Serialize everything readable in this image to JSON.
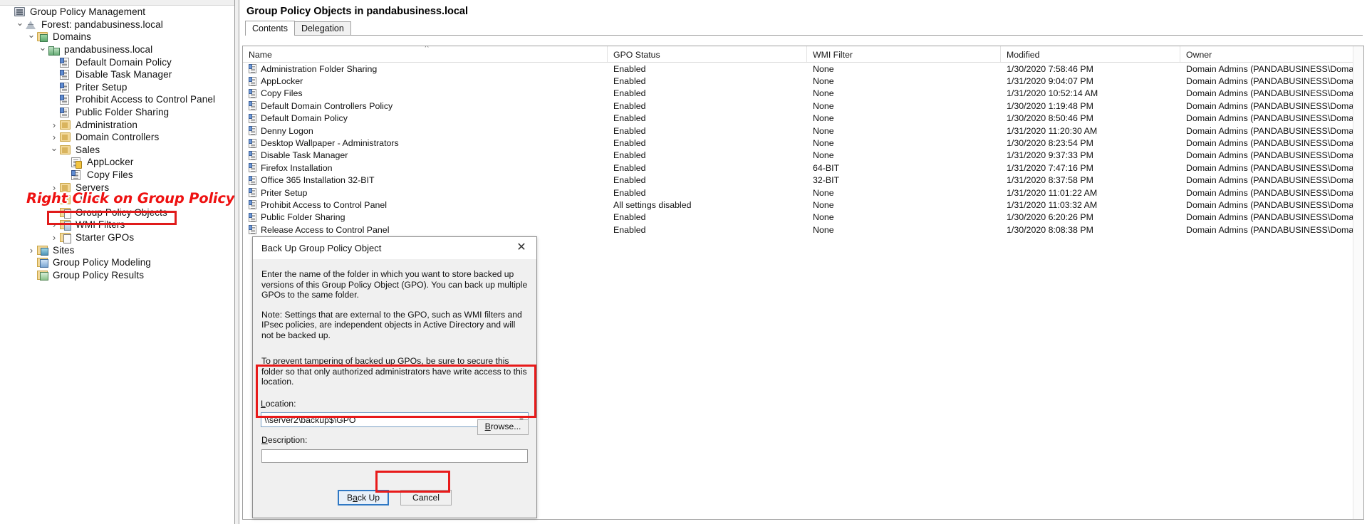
{
  "window": {
    "title": "Group Policy Management",
    "title_icon": "console-icon"
  },
  "tree": {
    "nodes": [
      {
        "label": "Group Policy Management",
        "depth": 0,
        "twisty": "",
        "icon": "gpm"
      },
      {
        "label": "Forest: pandabusiness.local",
        "depth": 1,
        "twisty": "expanded",
        "icon": "forest"
      },
      {
        "label": "Domains",
        "depth": 2,
        "twisty": "expanded",
        "icon": "domains"
      },
      {
        "label": "pandabusiness.local",
        "depth": 3,
        "twisty": "expanded",
        "icon": "domain"
      },
      {
        "label": "Default Domain Policy",
        "depth": 4,
        "twisty": "",
        "icon": "gpo"
      },
      {
        "label": "Disable Task Manager",
        "depth": 4,
        "twisty": "",
        "icon": "gpo"
      },
      {
        "label": "Priter Setup",
        "depth": 4,
        "twisty": "",
        "icon": "gpo"
      },
      {
        "label": "Prohibit Access to Control Panel",
        "depth": 4,
        "twisty": "",
        "icon": "gpo"
      },
      {
        "label": "Public Folder Sharing",
        "depth": 4,
        "twisty": "",
        "icon": "gpo"
      },
      {
        "label": "Administration",
        "depth": 4,
        "twisty": "collapsed",
        "icon": "ou"
      },
      {
        "label": "Domain Controllers",
        "depth": 4,
        "twisty": "collapsed",
        "icon": "ou"
      },
      {
        "label": "Sales",
        "depth": 4,
        "twisty": "expanded",
        "icon": "ou"
      },
      {
        "label": "AppLocker",
        "depth": 5,
        "twisty": "",
        "icon": "gpo-lock"
      },
      {
        "label": "Copy Files",
        "depth": 5,
        "twisty": "",
        "icon": "gpo"
      },
      {
        "label": "Servers",
        "depth": 4,
        "twisty": "collapsed",
        "icon": "ou"
      },
      {
        "label": "Users",
        "depth": 4,
        "twisty": "collapsed",
        "icon": "ou"
      },
      {
        "label": "Group Policy Objects",
        "depth": 4,
        "twisty": "",
        "icon": "gpo-container",
        "selected": true
      },
      {
        "label": "WMI Filters",
        "depth": 4,
        "twisty": "collapsed",
        "icon": "wmi"
      },
      {
        "label": "Starter GPOs",
        "depth": 4,
        "twisty": "collapsed",
        "icon": "starter"
      },
      {
        "label": "Sites",
        "depth": 2,
        "twisty": "collapsed",
        "icon": "sites"
      },
      {
        "label": "Group Policy Modeling",
        "depth": 2,
        "twisty": "",
        "icon": "modeling"
      },
      {
        "label": "Group Policy Results",
        "depth": 2,
        "twisty": "",
        "icon": "results"
      }
    ]
  },
  "annotation": {
    "text": "Right Click on Group Policy Objects and select backup。",
    "color": "#ee1111"
  },
  "right_pane": {
    "title": "Group Policy Objects in pandabusiness.local",
    "tabs": [
      {
        "label": "Contents",
        "active": true
      },
      {
        "label": "Delegation",
        "active": false
      }
    ],
    "columns": [
      "Name",
      "GPO Status",
      "WMI Filter",
      "Modified",
      "Owner"
    ],
    "sort_column": "Name",
    "sort_caret": "^",
    "rows": [
      {
        "name": "Administration Folder Sharing",
        "status": "Enabled",
        "wmi": "None",
        "modified": "1/30/2020 7:58:46 PM",
        "owner": "Domain Admins (PANDABUSINESS\\Domain ..."
      },
      {
        "name": "AppLocker",
        "status": "Enabled",
        "wmi": "None",
        "modified": "1/31/2020 9:04:07 PM",
        "owner": "Domain Admins (PANDABUSINESS\\Domain ..."
      },
      {
        "name": "Copy Files",
        "status": "Enabled",
        "wmi": "None",
        "modified": "1/31/2020 10:52:14 AM",
        "owner": "Domain Admins (PANDABUSINESS\\Domain ..."
      },
      {
        "name": "Default Domain Controllers Policy",
        "status": "Enabled",
        "wmi": "None",
        "modified": "1/30/2020 1:19:48 PM",
        "owner": "Domain Admins (PANDABUSINESS\\Domain ..."
      },
      {
        "name": "Default Domain Policy",
        "status": "Enabled",
        "wmi": "None",
        "modified": "1/30/2020 8:50:46 PM",
        "owner": "Domain Admins (PANDABUSINESS\\Domain ..."
      },
      {
        "name": "Denny Logon",
        "status": "Enabled",
        "wmi": "None",
        "modified": "1/31/2020 11:20:30 AM",
        "owner": "Domain Admins (PANDABUSINESS\\Domain ..."
      },
      {
        "name": "Desktop Wallpaper - Administrators",
        "status": "Enabled",
        "wmi": "None",
        "modified": "1/30/2020 8:23:54 PM",
        "owner": "Domain Admins (PANDABUSINESS\\Domain ..."
      },
      {
        "name": "Disable Task Manager",
        "status": "Enabled",
        "wmi": "None",
        "modified": "1/31/2020 9:37:33 PM",
        "owner": "Domain Admins (PANDABUSINESS\\Domain ..."
      },
      {
        "name": "Firefox Installation",
        "status": "Enabled",
        "wmi": "64-BIT",
        "modified": "1/31/2020 7:47:16 PM",
        "owner": "Domain Admins (PANDABUSINESS\\Domain ..."
      },
      {
        "name": "Office 365 Installation 32-BIT",
        "status": "Enabled",
        "wmi": "32-BIT",
        "modified": "1/31/2020 8:37:58 PM",
        "owner": "Domain Admins (PANDABUSINESS\\Domain ..."
      },
      {
        "name": "Priter Setup",
        "status": "Enabled",
        "wmi": "None",
        "modified": "1/31/2020 11:01:22 AM",
        "owner": "Domain Admins (PANDABUSINESS\\Domain ..."
      },
      {
        "name": "Prohibit Access to Control Panel",
        "status": "All settings disabled",
        "wmi": "None",
        "modified": "1/31/2020 11:03:32 AM",
        "owner": "Domain Admins (PANDABUSINESS\\Domain ..."
      },
      {
        "name": "Public Folder Sharing",
        "status": "Enabled",
        "wmi": "None",
        "modified": "1/30/2020 6:20:26 PM",
        "owner": "Domain Admins (PANDABUSINESS\\Domain ..."
      },
      {
        "name": "Release Access to Control Panel",
        "status": "Enabled",
        "wmi": "None",
        "modified": "1/30/2020 8:08:38 PM",
        "owner": "Domain Admins (PANDABUSINESS\\Domain ..."
      }
    ]
  },
  "dialog": {
    "title": "Back Up Group Policy Object",
    "close_icon": "close-icon",
    "paragraph1": "Enter the name of the folder in which you want to store backed up versions of this Group Policy Object (GPO). You can back up multiple GPOs to the same folder.",
    "paragraph2": "Note: Settings that are external to the GPO, such as WMI filters and IPsec policies, are independent objects in Active Directory and will not be backed up.",
    "paragraph3": "To prevent tampering of backed up GPOs, be sure to secure this folder so that only authorized administrators have write access to this location.",
    "location_label": "Location:",
    "location_value": "\\\\server2\\backup$\\GPO",
    "location_placeholder": "",
    "browse_label": "Browse...",
    "description_label": "Description:",
    "description_value": "",
    "description_placeholder": "",
    "backup_label": "Back Up",
    "cancel_label": "Cancel",
    "dropdown_icon": "chevron-down-icon"
  },
  "highlights": {
    "color": "#e81a1a",
    "regions": [
      "group-policy-objects-tree-node",
      "location-field-group",
      "back-up-button"
    ]
  }
}
